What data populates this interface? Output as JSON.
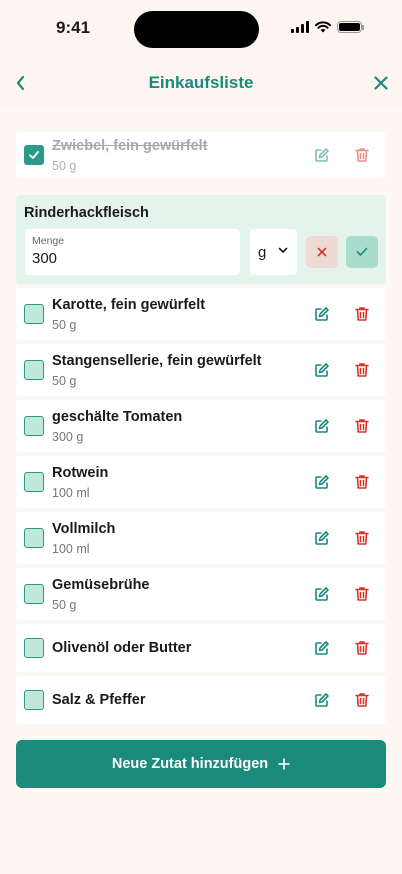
{
  "status": {
    "time": "9:41"
  },
  "header": {
    "title": "Einkaufsliste",
    "back_icon": "chevron-left-icon",
    "close_icon": "close-icon"
  },
  "colors": {
    "accent": "#1a8a7c",
    "danger": "#d9342b",
    "checkbox_fill": "#bfe7da",
    "background": "#fdf6f0"
  },
  "done_items": [
    {
      "name": "Zwiebel, fein gewürfelt",
      "quantity": "50 g",
      "checked": true
    }
  ],
  "editing": {
    "name": "Rinderhackfleisch",
    "amount_label": "Menge",
    "amount_value": "300",
    "unit": "g"
  },
  "items": [
    {
      "name": "Karotte, fein gewürfelt",
      "quantity": "50 g"
    },
    {
      "name": "Stangensellerie, fein gewürfelt",
      "quantity": "50 g"
    },
    {
      "name": "geschälte Tomaten",
      "quantity": "300 g"
    },
    {
      "name": "Rotwein",
      "quantity": "100 ml"
    },
    {
      "name": "Vollmilch",
      "quantity": "100 ml"
    },
    {
      "name": "Gemüsebrühe",
      "quantity": "50 g"
    },
    {
      "name": "Olivenöl oder Butter",
      "quantity": ""
    },
    {
      "name": "Salz & Pfeffer",
      "quantity": ""
    }
  ],
  "add_button": {
    "label": "Neue Zutat hinzufügen",
    "icon": "plus-icon"
  }
}
